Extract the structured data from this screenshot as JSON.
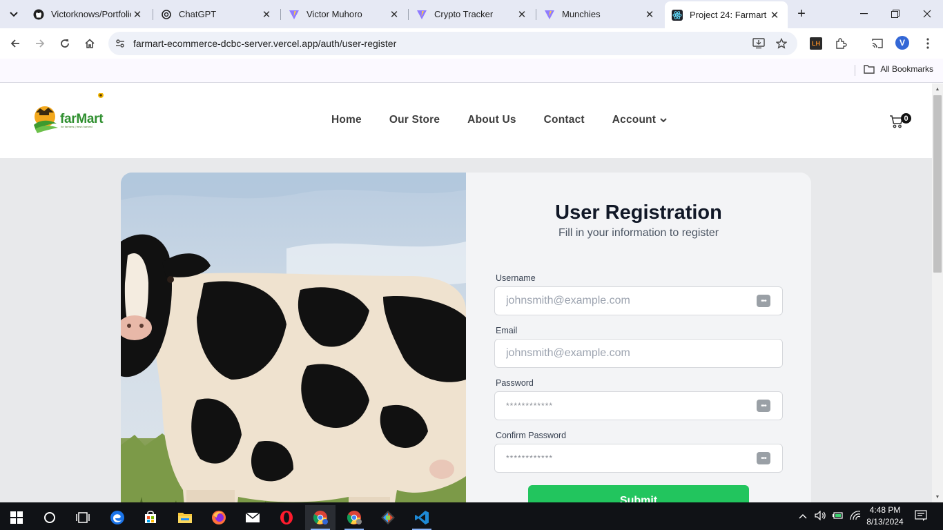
{
  "browser": {
    "tabs": [
      {
        "title": "Victorknows/Portfolio",
        "favicon": "github-icon"
      },
      {
        "title": "ChatGPT",
        "favicon": "chatgpt-icon"
      },
      {
        "title": "Victor Muhoro",
        "favicon": "vite-icon"
      },
      {
        "title": "Crypto Tracker",
        "favicon": "vite-icon"
      },
      {
        "title": "Munchies",
        "favicon": "vite-icon"
      },
      {
        "title": "Project 24: Farmart",
        "favicon": "react-icon",
        "active": true
      }
    ],
    "url": "farmart-ecommerce-dcbc-server.vercel.app/auth/user-register",
    "profile_initial": "V",
    "extension_label": "LH",
    "bookmarks_label": "All Bookmarks"
  },
  "site": {
    "logo_text": "farMart",
    "logo_tagline": "for farmers | fresh harvest",
    "nav": [
      "Home",
      "Our Store",
      "About Us",
      "Contact",
      "Account"
    ],
    "cart_count": "0"
  },
  "form": {
    "title": "User Registration",
    "subtitle": "Fill in your information to register",
    "username_label": "Username",
    "username_placeholder": "johnsmith@example.com",
    "email_label": "Email",
    "email_placeholder": "johnsmith@example.com",
    "password_label": "Password",
    "password_placeholder": "************",
    "confirm_label": "Confirm Password",
    "confirm_placeholder": "************",
    "submit_label": "Submit"
  },
  "taskbar": {
    "time": "4:48 PM",
    "date": "8/13/2024"
  },
  "colors": {
    "accent_green": "#22c55e",
    "brand_green": "#2f8f2f",
    "page_bg": "#e8e9eb"
  }
}
